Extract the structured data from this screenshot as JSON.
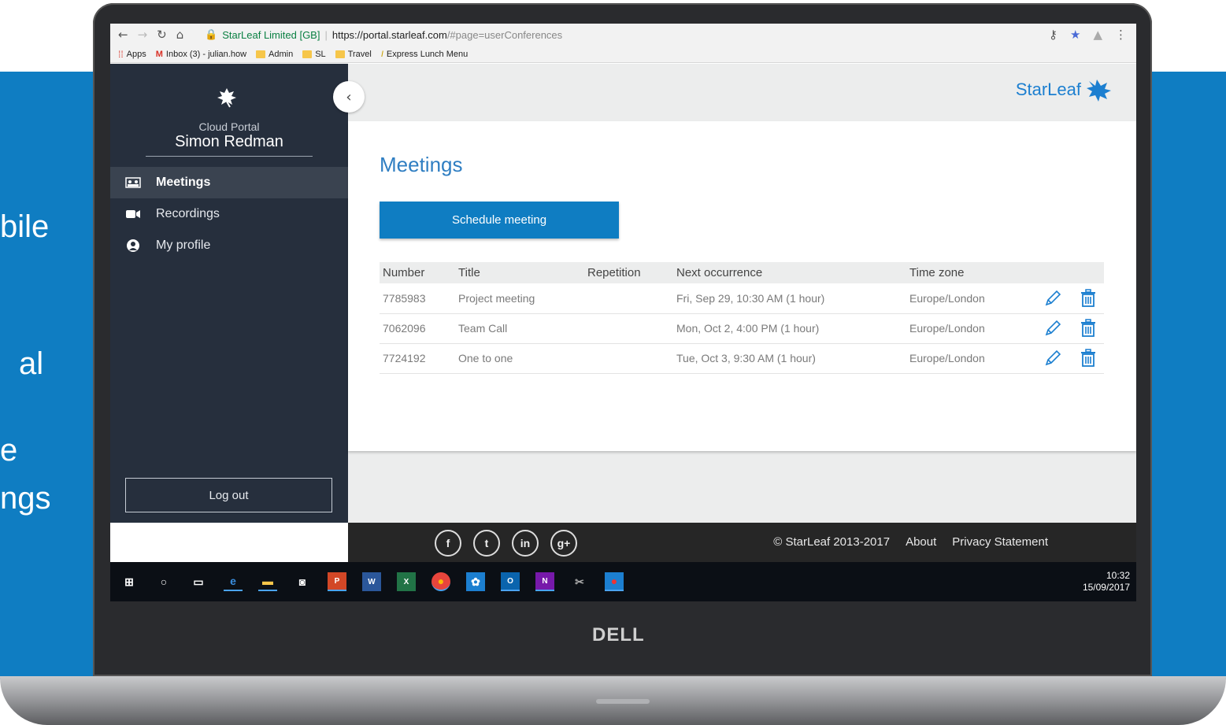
{
  "background_text": [
    "bile",
    "al",
    "e",
    "ngs"
  ],
  "browser": {
    "secure_label": "StarLeaf Limited [GB]",
    "url_host": "https://portal.starleaf.com",
    "url_path": "/#page=userConferences"
  },
  "bookmarks": [
    {
      "label": "Apps",
      "icon": "apps-grid-icon"
    },
    {
      "label": "Inbox (3) - julian.how",
      "icon": "gmail-icon"
    },
    {
      "label": "Admin",
      "icon": "folder-icon"
    },
    {
      "label": "SL",
      "icon": "folder-icon"
    },
    {
      "label": "Travel",
      "icon": "folder-icon"
    },
    {
      "label": "Express Lunch Menu",
      "icon": "bookmark-page-icon"
    }
  ],
  "sidebar": {
    "portal_label": "Cloud Portal",
    "user_name": "Simon Redman",
    "items": [
      {
        "label": "Meetings",
        "icon": "meetings-icon",
        "active": true
      },
      {
        "label": "Recordings",
        "icon": "recordings-icon",
        "active": false
      },
      {
        "label": "My profile",
        "icon": "profile-icon",
        "active": false
      }
    ],
    "logout_label": "Log out"
  },
  "header": {
    "brand": "StarLeaf"
  },
  "main": {
    "title": "Meetings",
    "schedule_label": "Schedule meeting",
    "columns": [
      "Number",
      "Title",
      "Repetition",
      "Next occurrence",
      "Time zone"
    ],
    "rows": [
      {
        "number": "7785983",
        "title": "Project meeting",
        "repetition": "",
        "next": "Fri, Sep 29, 10:30 AM (1 hour)",
        "tz": "Europe/London"
      },
      {
        "number": "7062096",
        "title": "Team Call",
        "repetition": "",
        "next": "Mon, Oct 2, 4:00 PM (1 hour)",
        "tz": "Europe/London"
      },
      {
        "number": "7724192",
        "title": "One to one",
        "repetition": "",
        "next": "Tue, Oct 3, 9:30 AM (1 hour)",
        "tz": "Europe/London"
      }
    ]
  },
  "footer": {
    "social": [
      "f",
      "t",
      "in",
      "g+"
    ],
    "copyright": "© StarLeaf 2013-2017",
    "about": "About",
    "privacy": "Privacy Statement"
  },
  "taskbar": {
    "time": "10:32",
    "date": "15/09/2017"
  },
  "device": {
    "brand": "DELL"
  },
  "colors": {
    "accent": "#0f7dc2",
    "sidebar": "#262f3d",
    "title": "#2f7ec2",
    "icon": "#1c7fd0"
  }
}
